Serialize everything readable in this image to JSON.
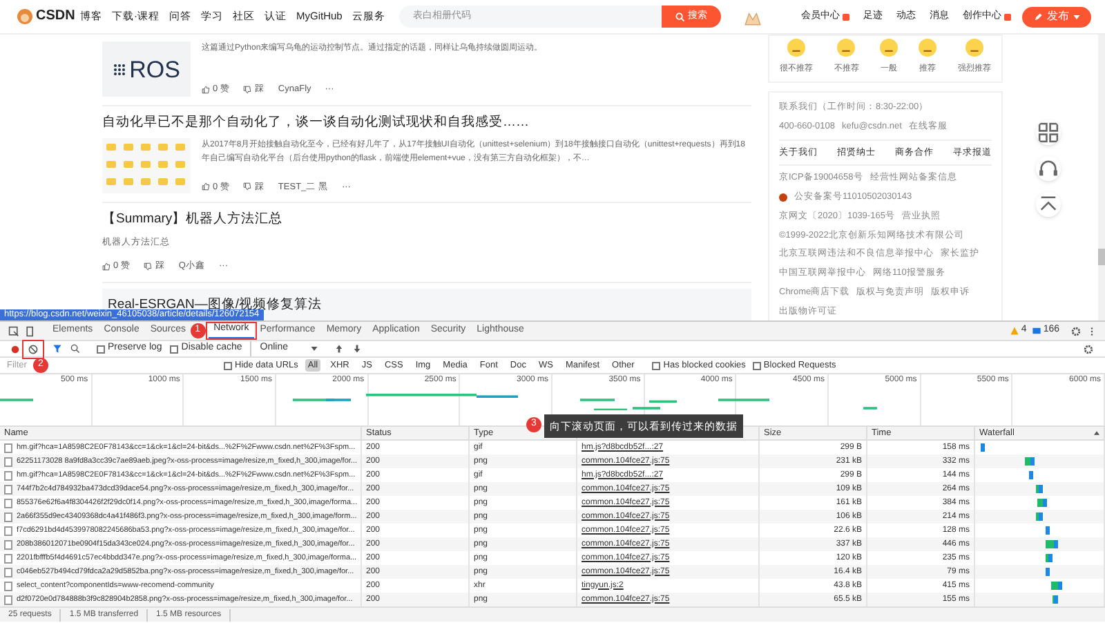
{
  "top_nav": {
    "logo": "CSDN",
    "items": [
      "博客",
      "下载·课程",
      "问答",
      "学习",
      "社区",
      "认证",
      "MyGitHub",
      "云服务"
    ],
    "search": {
      "placeholder": "表白相册代码",
      "button": "搜索"
    },
    "right_items": [
      "会员中心",
      "足迹",
      "动态",
      "消息",
      "创作中心"
    ],
    "publish": "发布"
  },
  "articles": [
    {
      "description": "这篇通过Python来编写乌龟的运动控制节点。通过指定的话题，同样让乌龟持续做圆周运动。",
      "thumbnail": {
        "kind": "logo",
        "text": "ROS"
      },
      "likes": "0 赞",
      "dislike": "踩",
      "author": "CynaFly",
      "more": "···",
      "hovered": false
    },
    {
      "title": "自动化早已不是那个自动化了，谈一谈自动化测试现状和自我感受……",
      "description": "从2017年8月开始接触自动化至今，已经有好几年了，从17年接触UI自动化（unittest+selenium）到18年接触接口自动化（unittest+requests）再到18年自己编写自动化平台（后台使用python的flask，前端使用element+vue，没有第三方自动化框架），不…",
      "likes": "0 赞",
      "dislike": "踩",
      "author": "TEST_二 黑",
      "more": "···",
      "hovered": false
    },
    {
      "title": "【Summary】机器人方法汇总",
      "description": "机器人方法汇总",
      "likes": "0 赞",
      "dislike": "踩",
      "author": "Q小鑫",
      "more": "···",
      "hovered": false
    },
    {
      "title": "Real-ESRGAN—图像/视频修复算法",
      "hovered": true
    }
  ],
  "status_url": "https://blog.csdn.net/weixin_46105038/article/details/126072154",
  "sidebar": {
    "ratings": [
      "很不推荐",
      "不推荐",
      "一般",
      "推荐",
      "强烈推荐"
    ],
    "contact": {
      "hours": "联系我们（工作时间：8:30-22:00）",
      "phone": "400-660-0108",
      "email": "kefu@csdn.net",
      "service": "在线客服"
    },
    "links": [
      "关于我们",
      "招贤纳士",
      "商务合作",
      "寻求报道"
    ],
    "footer_lines": [
      [
        "京ICP备19004658号",
        "经营性网站备案信息"
      ],
      [
        "公安备案号11010502030143"
      ],
      [
        "京网文〔2020〕1039-165号",
        "营业执照"
      ],
      [
        "©1999-2022北京创新乐知网络技术有限公司"
      ],
      [
        "北京互联网违法和不良信息举报中心",
        "家长监护"
      ],
      [
        "中国互联网举报中心",
        "网络110报警服务"
      ],
      [
        "Chrome商店下载",
        "版权与免责声明",
        "版权申诉"
      ],
      [
        "出版物许可证"
      ]
    ]
  },
  "devtools": {
    "tabs": [
      {
        "label": "Elements",
        "selected": false
      },
      {
        "label": "Console",
        "selected": false
      },
      {
        "label": "Sources",
        "selected": false
      },
      {
        "label": "Network",
        "selected": true
      },
      {
        "label": "Performance",
        "selected": false
      },
      {
        "label": "Memory",
        "selected": false
      },
      {
        "label": "Application",
        "selected": false
      },
      {
        "label": "Security",
        "selected": false
      },
      {
        "label": "Lighthouse",
        "selected": false
      }
    ],
    "warnings": "4",
    "messages": "166",
    "toolbar": {
      "preserve_log": {
        "label": "Preserve log",
        "checked": false
      },
      "disable_cache": {
        "label": "Disable cache",
        "checked": false
      },
      "throttling": "Online"
    },
    "filter": {
      "placeholder": "Filter",
      "hide_data_urls": {
        "label": "Hide data URLs",
        "checked": false
      },
      "types": [
        {
          "label": "All",
          "selected": true
        },
        {
          "label": "XHR",
          "selected": false
        },
        {
          "label": "JS",
          "selected": false
        },
        {
          "label": "CSS",
          "selected": false
        },
        {
          "label": "Img",
          "selected": false
        },
        {
          "label": "Media",
          "selected": false
        },
        {
          "label": "Font",
          "selected": false
        },
        {
          "label": "Doc",
          "selected": false
        },
        {
          "label": "WS",
          "selected": false
        },
        {
          "label": "Manifest",
          "selected": false
        },
        {
          "label": "Other",
          "selected": false
        }
      ],
      "blocked_cookies": {
        "label": "Has blocked cookies",
        "checked": false
      },
      "blocked_requests": {
        "label": "Blocked Requests",
        "checked": false
      }
    },
    "timeline_ticks": [
      "500 ms",
      "1000 ms",
      "1500 ms",
      "2000 ms",
      "2500 ms",
      "3000 ms",
      "3500 ms",
      "4000 ms",
      "4500 ms",
      "5000 ms",
      "5500 ms",
      "6000 ms"
    ],
    "table": {
      "columns": [
        "Name",
        "Status",
        "Type",
        "",
        "Size",
        "Time",
        "Waterfall"
      ],
      "rows": [
        [
          "hm.gif?hca=1A8598C2E0F78143&cc=1&ck=1&cl=24-bit&ds...%2F%2Fwww.csdn.net%2F%3Fspm...",
          "200",
          "gif",
          "hm.js?d8bcdb52f...:27",
          "299 B",
          "158 ms"
        ],
        [
          "62251173028 8a9fd8a3cc39c7ae89aeb.jpeg?x-oss-process=image/resize,m_fixed,h_300,image/for...",
          "200",
          "png",
          "common.104fce27.js:75",
          "231 kB",
          "332 ms"
        ],
        [
          "hm.gif?hca=1A8598C2E0F78143&cc=1&ck=1&cl=24-bit&ds...%2F%2Fwww.csdn.net%2F%3Fspm...",
          "200",
          "gif",
          "hm.js?d8bcdb52f...:27",
          "299 B",
          "144 ms"
        ],
        [
          "744f7b2c4d784932ba473dcd39dace54.png?x-oss-process=image/resize,m_fixed,h_300,image/for...",
          "200",
          "png",
          "common.104fce27.js:75",
          "109 kB",
          "264 ms"
        ],
        [
          "855376e62f6a4f8304426f2f29dc0f14.png?x-oss-process=image/resize,m_fixed,h_300,image/forma...",
          "200",
          "png",
          "common.104fce27.js:75",
          "161 kB",
          "384 ms"
        ],
        [
          "2a66f355d9ec43409368dc4a41f486f3.png?x-oss-process=image/resize,m_fixed,h_300,image/form...",
          "200",
          "png",
          "common.104fce27.js:75",
          "106 kB",
          "214 ms"
        ],
        [
          "f7cd6291bd4d4539978082245686ba53.png?x-oss-process=image/resize,m_fixed,h_300,image/for...",
          "200",
          "png",
          "common.104fce27.js:75",
          "22.6 kB",
          "128 ms"
        ],
        [
          "208b386012071be0904f15da343ce024.png?x-oss-process=image/resize,m_fixed,h_300,image/for...",
          "200",
          "png",
          "common.104fce27.js:75",
          "337 kB",
          "446 ms"
        ],
        [
          "2201fbfffb5f4d4691c57ec4bbdd347e.png?x-oss-process=image/resize,m_fixed,h_300,image/forma...",
          "200",
          "png",
          "common.104fce27.js:75",
          "120 kB",
          "235 ms"
        ],
        [
          "c046eb527b494cd79fdca2a29d5852ba.png?x-oss-process=image/resize,m_fixed,h_300,image/for...",
          "200",
          "png",
          "common.104fce27.js:75",
          "16.4 kB",
          "79 ms"
        ],
        [
          "select_content?componentIds=www-recomend-community",
          "200",
          "xhr",
          "tingyun.js:2",
          "43.8 kB",
          "415 ms"
        ],
        [
          "d2f0720e0d784888b3f9c828904b2858.png?x-oss-process=image/resize,m_fixed,h_300,image/for...",
          "200",
          "png",
          "common.104fce27.js:75",
          "65.5 kB",
          "155 ms"
        ]
      ]
    },
    "status_bar": [
      "25 requests",
      "1.5 MB transferred",
      "1.5 MB resources"
    ]
  },
  "annotations": [
    {
      "label": "1"
    },
    {
      "label": "2"
    },
    {
      "label": "3",
      "note": "向下滚动页面，可以看到传过来的数据"
    }
  ]
}
